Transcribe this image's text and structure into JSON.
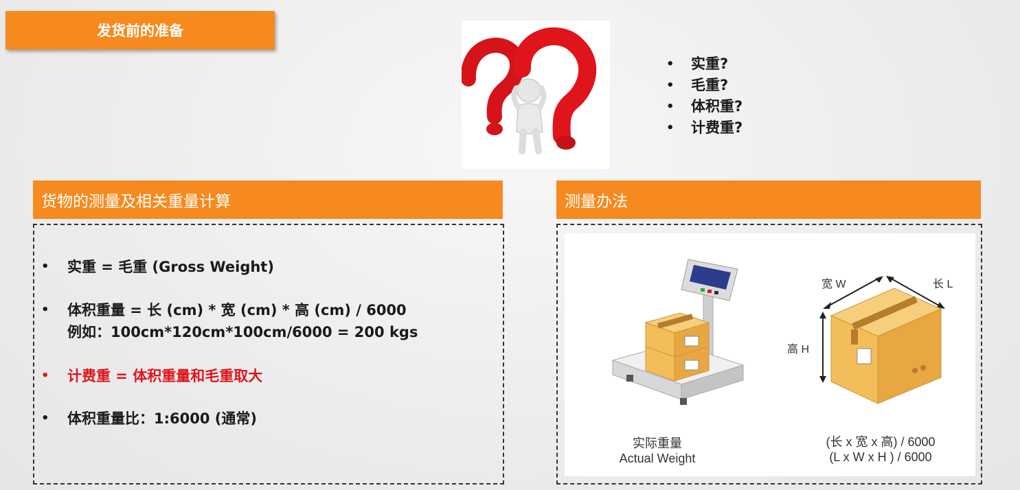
{
  "slide": {
    "title": "发货前的准备"
  },
  "questions": [
    "实重?",
    "毛重?",
    "体积重?",
    "计费重?"
  ],
  "left_panel": {
    "header": "货物的测量及相关重量计算",
    "items": [
      {
        "line1": "实重 = 毛重   (Gross Weight)",
        "line2": ""
      },
      {
        "line1": "体积重量 = 长 (cm) * 宽 (cm) * 高 (cm) / 6000",
        "line2": "例如：100cm*120cm*100cm/6000 = 200 kgs"
      },
      {
        "line1": "计费重 = 体积重量和毛重取大",
        "line2": ""
      },
      {
        "line1": "体积重量比：1:6000   (通常)",
        "line2": ""
      }
    ]
  },
  "right_panel": {
    "header": "测量办法",
    "scale_caption_cn": "实际重量",
    "scale_caption_en": "Actual Weight",
    "box_formula_cn": "(长 x 宽 x 高) / 6000",
    "box_formula_en": "(L x W x H ) / 6000",
    "label_width": "宽 W",
    "label_length": "长 L",
    "label_height": "高 H"
  },
  "colors": {
    "accent": "#f68a1e",
    "highlight_red": "#e0141b"
  }
}
